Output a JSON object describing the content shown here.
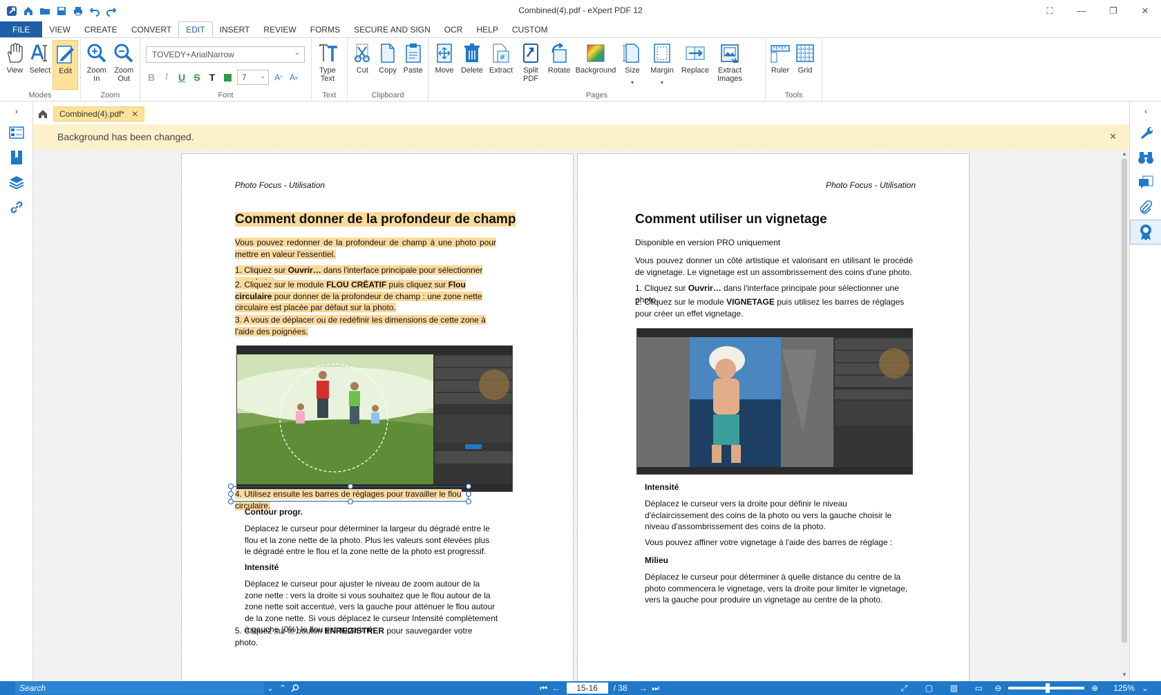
{
  "window": {
    "title": "Combined(4).pdf   -   eXpert PDF 12"
  },
  "menu": [
    "FILE",
    "VIEW",
    "CREATE",
    "CONVERT",
    "EDIT",
    "INSERT",
    "REVIEW",
    "FORMS",
    "SECURE AND SIGN",
    "OCR",
    "HELP",
    "CUSTOM"
  ],
  "ribbon": {
    "modes": {
      "label": "Modes",
      "view": "View",
      "select": "Select",
      "edit": "Edit"
    },
    "zoom": {
      "label": "Zoom",
      "zoom_in": "Zoom\nIn",
      "zoom_out": "Zoom\nOut"
    },
    "font": {
      "label": "Font",
      "font_name": "TOVEDY+ArialNarrow",
      "font_size": "7"
    },
    "text": {
      "label": "Text",
      "type_text": "Type\nText"
    },
    "clipboard": {
      "label": "Clipboard",
      "cut": "Cut",
      "copy": "Copy",
      "paste": "Paste"
    },
    "pages": {
      "label": "Pages",
      "move": "Move",
      "delete": "Delete",
      "extract": "Extract",
      "split": "Split\nPDF",
      "rotate": "Rotate",
      "background": "Background",
      "size": "Size",
      "margin": "Margin",
      "replace": "Replace",
      "extract_images": "Extract\nImages"
    },
    "tools": {
      "label": "Tools",
      "ruler": "Ruler",
      "grid": "Grid"
    }
  },
  "tab": {
    "name": "Combined(4).pdf*"
  },
  "notification": "Background has been changed.",
  "page1": {
    "header": "Photo Focus - Utilisation",
    "title": "Comment donner de la profondeur de champ",
    "intro": "Vous pouvez redonner de la profondeur de champ à une photo pour mettre en valeur l'essentiel.",
    "step1_a": "1. Cliquez sur ",
    "step1_b": "Ouvrir…",
    "step1_c": " dans l'interface principale pour sélectionner une photo.",
    "step2_a": "2. Cliquez sur le module ",
    "step2_b": "FLOU CRÉATIF",
    "step2_c": " puis cliquez sur ",
    "step2_d": "Flou circulaire",
    "step2_e": " pour donner de la profondeur de champ : une zone nette circulaire est placée par défaut sur la photo.",
    "step3": "3. A vous de déplacer ou de redéfinir les dimensions de cette zone à l'aide des poignées.",
    "step4": "4. Utilisez ensuite les barres de réglages pour travailler le flou circulaire.",
    "sub1": "Contour progr.",
    "para1": "Déplacez le curseur pour déterminer la largeur du dégradé entre le flou et la zone nette de la photo. Plus les valeurs sont élevées plus le dégradé entre le flou et la zone nette de la photo est progressif.",
    "sub2": "Intensité",
    "para2": "Déplacez le curseur pour ajuster le niveau de  zoom autour de la zone nette : vers la droite si vous souhaitez que le flou autour de la zone nette soit accentué, vers la gauche pour atténuer le flou autour de la zone nette. Si vous déplacez le curseur Intensité complètement à gauche (0%) le flou est supprimé.",
    "step5_a": "5. Cliquez  sur le bouton ",
    "step5_b": "ENREGISTRER",
    "step5_c": " pour sauvegarder votre photo."
  },
  "page2": {
    "header": "Photo Focus - Utilisation",
    "title": "Comment utiliser un vignetage",
    "avail": "Disponible en version PRO uniquement",
    "intro": "Vous pouvez donner un côté artistique et valorisant en utilisant le procédé de vignetage. Le vignetage est un assombrissement des coins d'une photo.",
    "step1_a": "1. Cliquez sur ",
    "step1_b": "Ouvrir…",
    "step1_c": " dans l'interface principale pour sélectionner une photo.",
    "step2_a": "2. Cliquez sur le module ",
    "step2_b": "VIGNETAGE",
    "step2_c": " puis utilisez les barres de réglages pour créer un effet vignetage.",
    "sub1": "Intensité",
    "para1": "Déplacez le curseur vers la droite pour définir le niveau d'éclaircissement des coins de la photo ou vers la gauche choisir le niveau d'assombrissement des coins de la photo.",
    "para2": "Vous pouvez affiner votre vignetage à l'aide des barres de réglage :",
    "sub2": "Milieu",
    "para3": "Déplacez le curseur pour déterminer à quelle distance du centre de la photo commencera le vignetage, vers la droite pour limiter le vignetage, vers la gauche pour produire un vignetage au centre de la photo."
  },
  "statusbar": {
    "search_placeholder": "Search",
    "current_page": "15-16",
    "total_pages": "/ 38",
    "zoom": "125%"
  },
  "colors": {
    "accent": "#1f78c8",
    "highlight": "#fbd99b",
    "notification_bg": "#fdf1cc"
  }
}
